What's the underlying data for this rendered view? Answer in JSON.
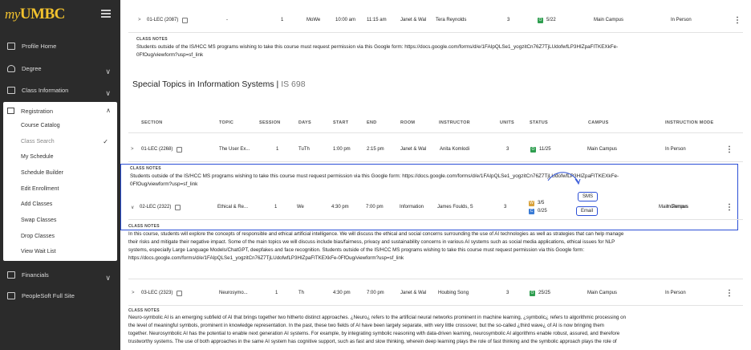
{
  "brand": {
    "my": "my",
    "umbc": "UMBC"
  },
  "sidebar": {
    "items": [
      {
        "label": "Profile Home"
      },
      {
        "label": "Degree"
      },
      {
        "label": "Class Information"
      },
      {
        "label": "Financials"
      },
      {
        "label": "PeopleSoft Full Site"
      }
    ],
    "registration": {
      "label": "Registration",
      "subitems": [
        {
          "label": "Course Catalog"
        },
        {
          "label": "Class Search"
        },
        {
          "label": "My Schedule"
        },
        {
          "label": "Schedule Builder"
        },
        {
          "label": "Edit Enrollment"
        },
        {
          "label": "Add Classes"
        },
        {
          "label": "Swap Classes"
        },
        {
          "label": "Drop Classes"
        },
        {
          "label": "View Wait List"
        }
      ]
    }
  },
  "top_row": {
    "section": "01-LEC (2087)",
    "topic": "-",
    "session": "1",
    "days": "MoWe",
    "start": "10:00 am",
    "end": "11:15 am",
    "room": "Janet & Wal",
    "instructor": "Tera Reynolds",
    "units": "3",
    "status": "5/22",
    "campus": "Main Campus",
    "mode": "In Person"
  },
  "top_notes": {
    "label": "CLASS NOTES",
    "line1": "Students outside of the IS/HCC MS programs wishing to take this course must request permission via this Google form: https://docs.google.com/forms/d/e/1FAIpQLSe1_yogzitCn76Z7TjLUdofwfLP3HIZpaFITKEXkFe-",
    "line2": "0FfOug/viewform?usp=sf_link"
  },
  "section": {
    "title": "Special Topics in Information Systems",
    "code": "IS 698"
  },
  "headers": {
    "section": "SECTION",
    "topic": "TOPIC",
    "session": "SESSION",
    "days": "DAYS",
    "start": "START",
    "end": "END",
    "room": "ROOM",
    "instructor": "INSTRUCTOR",
    "units": "UNITS",
    "status": "STATUS",
    "campus": "CAMPUS",
    "mode": "INSTRUCTION MODE"
  },
  "rows": [
    {
      "section": "01-LEC (2268)",
      "topic": "The User Ex...",
      "session": "1",
      "days": "TuTh",
      "start": "1:00 pm",
      "end": "2:15 pm",
      "room": "Janet & Wal",
      "instructor": "Anita Komlodi",
      "units": "3",
      "status": "11/25",
      "campus": "Main Campus",
      "mode": "In Person",
      "notes_label": "CLASS NOTES",
      "notes1": "Students outside of the IS/HCC MS programs wishing to take this course must request permission via this Google form: https://docs.google.com/forms/d/e/1FAIpQLSe1_yogzitCn76Z7TjLUdofwfLP3HIZpaFITKEXkFe-",
      "notes2": "0FfOug/viewform?usp=sf_link"
    },
    {
      "section": "02-LEC (2322)",
      "topic": "Ethical & Re...",
      "session": "1",
      "days": "We",
      "start": "4:30 pm",
      "end": "7:00 pm",
      "room": "Information",
      "instructor": "James Foulds, S",
      "units": "3",
      "status_wait": "3/5",
      "status_open": "0/25",
      "campus": "Main Campus",
      "mode": "In Person",
      "sms": "SMS",
      "email": "Email",
      "notes_label": "CLASS NOTES",
      "notes1": "In this course, students will explore the concepts of responsible and ethical artificial intelligence. We will discuss the ethical and social concerns surrounding the use of AI technologies as well as strategies that can help manage",
      "notes2": "their risks and mitigate their negative impact. Some of the main topics we will discuss include bias/fairness, privacy and sustainability concerns in various AI systems such as social media applications, ethical issues for NLP",
      "notes3": "systems, especially Large Language Models/ChatGPT, deepfakes and face recognition. Students outside of the IS/HCC MS programs wishing to take this course must request permission via this Google form:",
      "notes4": "https://docs.google.com/forms/d/e/1FAIpQLSe1_yogzitCn76Z7TjLUdofwfLP3HIZpaFITKEXkFe-0FfOug/viewform?usp=sf_link"
    },
    {
      "section": "03-LEC (2323)",
      "topic": "Neurosymo...",
      "session": "1",
      "days": "Th",
      "start": "4:30 pm",
      "end": "7:00 pm",
      "room": "Janet & Wal",
      "instructor": "Houbing Song",
      "units": "3",
      "status": "25/25",
      "campus": "Main Campus",
      "mode": "In Person",
      "notes_label": "CLASS NOTES",
      "notes1": "Neuro-symbolic AI is an emerging subfield of AI that brings together two hitherto distinct approaches. ¿Neuro¿ refers to the artificial neural networks prominent in machine learning, ¿symbolic¿ refers to algorithmic processing on",
      "notes2": "the level of meaningful symbols, prominent in knowledge representation. In the past, these two fields of AI have been largely separate, with very little crossover, but the so-called ¿third wave¿ of AI is now bringing them",
      "notes3": "together. Neurosymbolic AI has the potential to enable next generation AI systems. For example, by integrating symbolic reasoning with data-driven learning, neurosymbolic AI algorithms enable robust, assured, and therefore",
      "notes4": "trustworthy systems. The use of both approaches in the same AI system has cognitive support, such as fast and slow thinking, wherein deep learning plays the role of fast thinking and the symbolic approach plays the role of"
    }
  ],
  "colors": {
    "open": "#2e9e4f",
    "wait": "#d9a23b",
    "closed": "#3a7bd5",
    "accent": "#2b4fd6",
    "sidebar": "#2b2b2b",
    "brand": "#f2c22e"
  }
}
